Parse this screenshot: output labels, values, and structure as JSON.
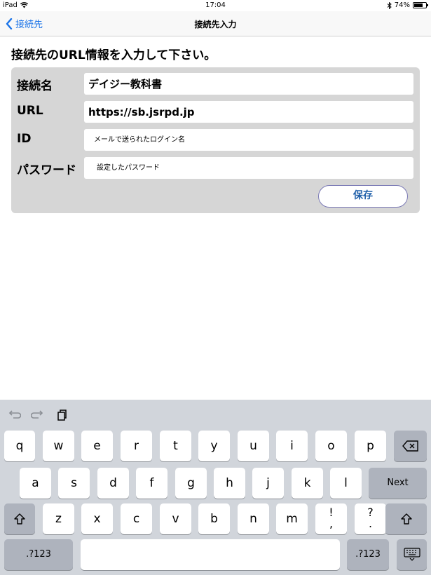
{
  "status_bar": {
    "device": "iPad",
    "time": "17:04",
    "battery": "74%",
    "battery_level": 0.74
  },
  "navbar": {
    "back_label": "接続先",
    "title": "接続先入力"
  },
  "prompt": "接続先のURL情報を入力して下さい。",
  "form": {
    "fields": [
      {
        "label": "接続名",
        "value": "デイジー教科書"
      },
      {
        "label": "URL",
        "value": "https://sb.jsrpd.jp"
      },
      {
        "label": "ID",
        "placeholder": "メールで送られたログイン名"
      },
      {
        "label": "パスワード",
        "placeholder": "設定したパスワード"
      }
    ],
    "save_label": "保存"
  },
  "keyboard": {
    "row1": [
      "q",
      "w",
      "e",
      "r",
      "t",
      "y",
      "u",
      "i",
      "o",
      "p"
    ],
    "row2": [
      "a",
      "s",
      "d",
      "f",
      "g",
      "h",
      "j",
      "k",
      "l"
    ],
    "row3": [
      "z",
      "x",
      "c",
      "v",
      "b",
      "n",
      "m"
    ],
    "punct1": {
      "top": "!",
      "bottom": ","
    },
    "punct2": {
      "top": "?",
      "bottom": "."
    },
    "next_label": "Next",
    "numbers_label": ".?123"
  }
}
